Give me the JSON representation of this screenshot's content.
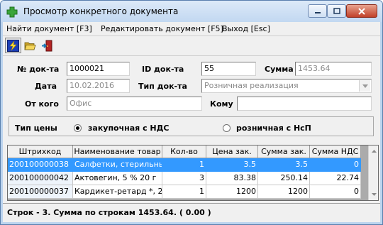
{
  "window": {
    "title": "Просмотр конкретного документа",
    "icon": "green-cross-icon"
  },
  "menu": {
    "items": [
      "Найти документ [F3]",
      "Редактировать документ [F5]",
      "Выход [Esc]"
    ]
  },
  "toolbar": {
    "buttons": [
      "lightning-icon",
      "open-folder-icon",
      "exit-door-icon"
    ]
  },
  "form": {
    "doc_no_label": "№ док-та",
    "doc_no": "1000021",
    "doc_id_label": "ID док-та",
    "doc_id": "55",
    "sum_label": "Сумма",
    "sum": "1453.64",
    "date_label": "Дата",
    "date": "10.02.2016",
    "doc_type_label": "Тип док-та",
    "doc_type": "Розничная реализация",
    "from_label": "От кого",
    "from": "Офис",
    "to_label": "Кому",
    "to": "",
    "price_type_label": "Тип цены",
    "price_options": [
      "закупочная с НДС",
      "розничная с НсП"
    ],
    "price_selected": 0
  },
  "grid": {
    "columns": [
      "Штрихкод",
      "Наименование товар",
      "Кол-во",
      "Цена зак.",
      "Сумма зак.",
      "Сумма НДС"
    ],
    "rows": [
      [
        "200100000038",
        "Салфетки, стерильные",
        "1",
        "3.5",
        "3.5",
        "0"
      ],
      [
        "200100000042",
        "Актовегин, 5 % 20 г",
        "3",
        "83.38",
        "250.14",
        "22.74"
      ],
      [
        "200100000037",
        "Кардикет-ретард *, 2",
        "1",
        "1200",
        "1200",
        "0"
      ]
    ],
    "selected_row": 0
  },
  "status": {
    "text": "Строк - 3. Сумма по строкам 1453.64. ( 0.00 )"
  },
  "colors": {
    "selection": "#3399ff",
    "titlebar": "#c2d8f1",
    "close_button": "#c1412a"
  }
}
